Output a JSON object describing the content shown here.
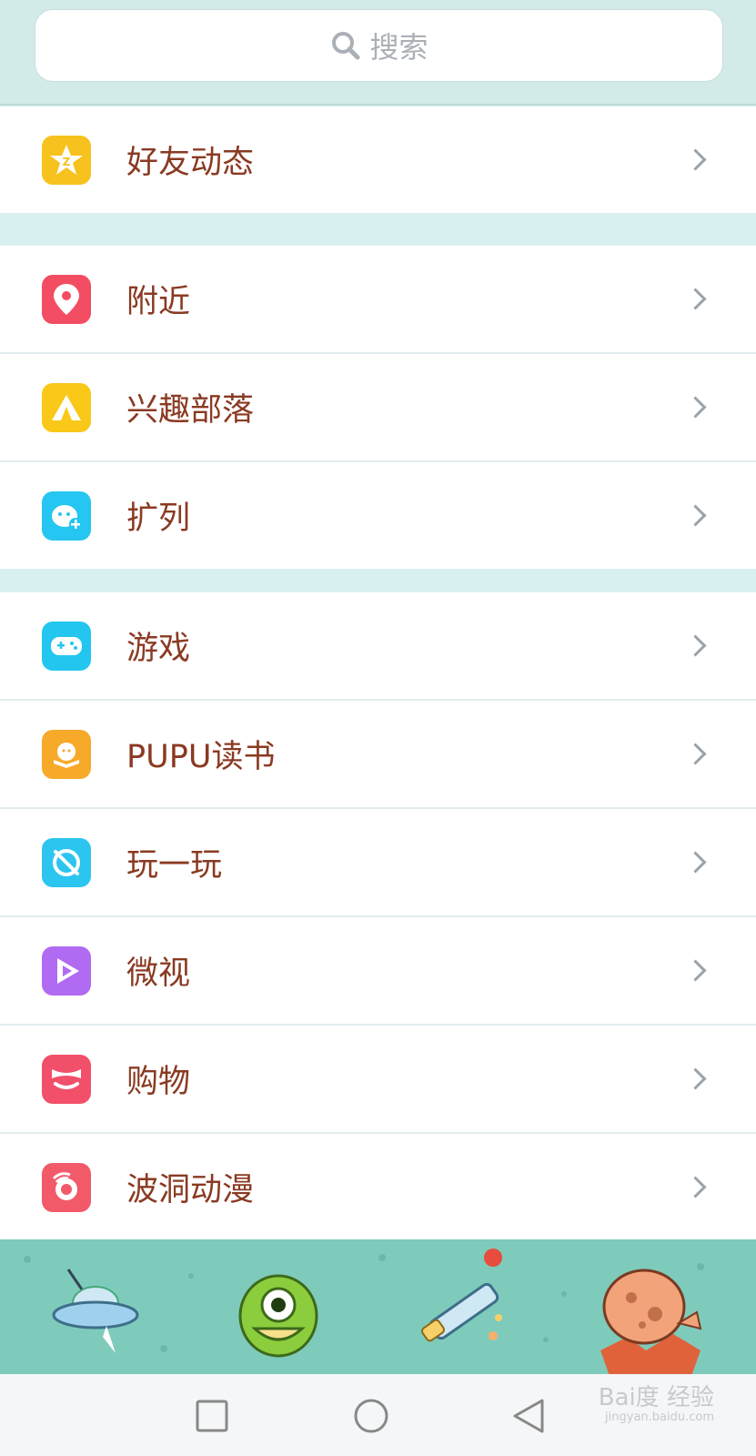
{
  "search": {
    "placeholder": "搜索"
  },
  "groups": [
    {
      "items": [
        {
          "label": "好友动态",
          "icon": "qzone-star-icon"
        }
      ]
    },
    {
      "items": [
        {
          "label": "附近",
          "icon": "location-pin-icon"
        },
        {
          "label": "兴趣部落",
          "icon": "tent-icon"
        },
        {
          "label": "扩列",
          "icon": "add-friend-face-icon"
        }
      ]
    },
    {
      "items": [
        {
          "label": "游戏",
          "icon": "gamepad-icon"
        },
        {
          "label": "PUPU读书",
          "icon": "book-icon"
        },
        {
          "label": "玩一玩",
          "icon": "planet-icon"
        },
        {
          "label": "微视",
          "icon": "play-video-icon"
        },
        {
          "label": "购物",
          "icon": "shopping-bow-icon"
        },
        {
          "label": "波洞动漫",
          "icon": "anime-icon"
        }
      ]
    }
  ],
  "tabbar": [
    "ufo-icon",
    "green-monster-icon",
    "telescope-icon",
    "asteroid-icon"
  ],
  "watermark": {
    "brand": "Bai度 经验",
    "url": "jingyan.baidu.com"
  },
  "colors": {
    "label": "#8a3a22",
    "qzone": "#f7c21d",
    "nearby": "#f24d62",
    "tribe": "#f9c818",
    "kuolie": "#25c6f1",
    "game": "#22c6ef",
    "pupu": "#f7a92a",
    "play": "#2bc5ef",
    "weishi": "#b16af2",
    "shop": "#f2506a",
    "anime": "#f25a6a"
  }
}
